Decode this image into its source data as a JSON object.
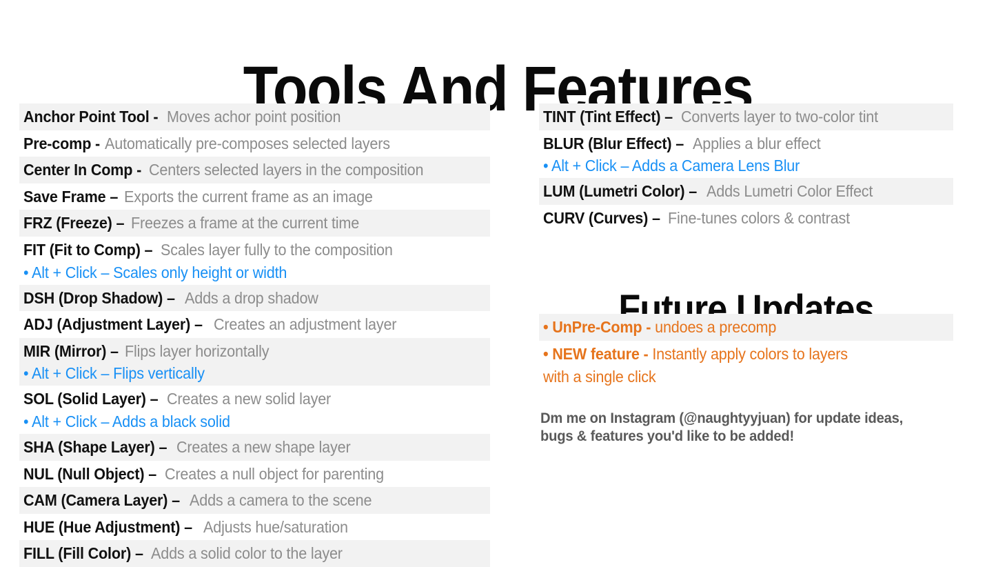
{
  "page": {
    "title": "Tools And Features",
    "background_color": "#ffffff",
    "accent_blue": "#1890f5",
    "accent_orange": "#e6741c",
    "term_color": "#111111",
    "desc_color": "#8c8c8c",
    "row_shade_color": "#f2f2f2"
  },
  "left_column": {
    "rows": [
      {
        "term": "Anchor Point Tool -",
        "desc": " Moves achor point position",
        "shaded": true,
        "alt": null
      },
      {
        "term": "Pre-comp -",
        "desc": " Automatically pre-composes selected layers",
        "shaded": false,
        "alt": null
      },
      {
        "term": "Center In Comp -",
        "desc": " Centers selected layers in the composition",
        "shaded": true,
        "alt": null
      },
      {
        "term": "Save Frame –",
        "desc": " Exports the current frame as an image",
        "shaded": false,
        "alt": null
      },
      {
        "term": "FRZ (Freeze) –",
        "desc": " Freezes a frame at the current time",
        "shaded": true,
        "alt": null
      },
      {
        "term": "FIT (Fit to Comp) –",
        "desc": " Scales layer fully to the composition",
        "shaded": false,
        "alt": "• Alt + Click – Scales only height or width"
      },
      {
        "term": "DSH (Drop Shadow) –",
        "desc": " Adds a drop shadow",
        "shaded": true,
        "alt": null
      },
      {
        "term": "ADJ (Adjustment Layer) –",
        "desc": " Creates an adjustment layer",
        "shaded": false,
        "alt": null
      },
      {
        "term": "MIR (Mirror) –",
        "desc": " Flips layer horizontally",
        "shaded": true,
        "alt": "• Alt + Click – Flips vertically"
      },
      {
        "term": "SOL (Solid Layer) –",
        "desc": " Creates a new solid layer",
        "shaded": false,
        "alt": "• Alt + Click – Adds a black solid"
      },
      {
        "term": "SHA (Shape Layer) –",
        "desc": " Creates a new shape layer",
        "shaded": true,
        "alt": null
      },
      {
        "term": "NUL (Null Object) –",
        "desc": " Creates a null object for parenting",
        "shaded": false,
        "alt": null
      },
      {
        "term": "CAM (Camera Layer) –",
        "desc": " Adds a camera to the scene",
        "shaded": true,
        "alt": null
      },
      {
        "term": "HUE (Hue Adjustment) –",
        "desc": " Adjusts hue/saturation",
        "shaded": false,
        "alt": null
      },
      {
        "term": "FILL (Fill Color) –",
        "desc": " Adds a solid color to the layer",
        "shaded": true,
        "alt": null
      }
    ]
  },
  "right_column": {
    "rows": [
      {
        "term": "TINT (Tint Effect) –",
        "desc": " Converts layer to two-color tint",
        "shaded": true,
        "alt": null
      },
      {
        "term": "BLUR (Blur Effect) –",
        "desc": " Applies a blur effect",
        "shaded": false,
        "alt": "• Alt + Click – Adds a Camera Lens Blur"
      },
      {
        "term": "LUM (Lumetri Color) –",
        "desc": " Adds Lumetri Color Effect",
        "shaded": true,
        "alt": null
      },
      {
        "term": "CURV (Curves) –",
        "desc": " Fine-tunes colors & contrast",
        "shaded": false,
        "alt": null
      }
    ]
  },
  "future_updates": {
    "title": "Future Updates",
    "items": [
      {
        "shaded": true,
        "lines": [
          {
            "term": "• UnPre-Comp -",
            "desc": " undoes a precomp"
          }
        ]
      },
      {
        "shaded": false,
        "lines": [
          {
            "term": "• NEW feature -",
            "desc": " Instantly apply colors to layers"
          },
          {
            "term": "",
            "desc": "with a single click"
          }
        ]
      }
    ]
  },
  "footer": {
    "line1": "Dm me on Instagram (@naughtyyjuan) for update ideas,",
    "line2": "bugs & features you'd like to be added!"
  }
}
